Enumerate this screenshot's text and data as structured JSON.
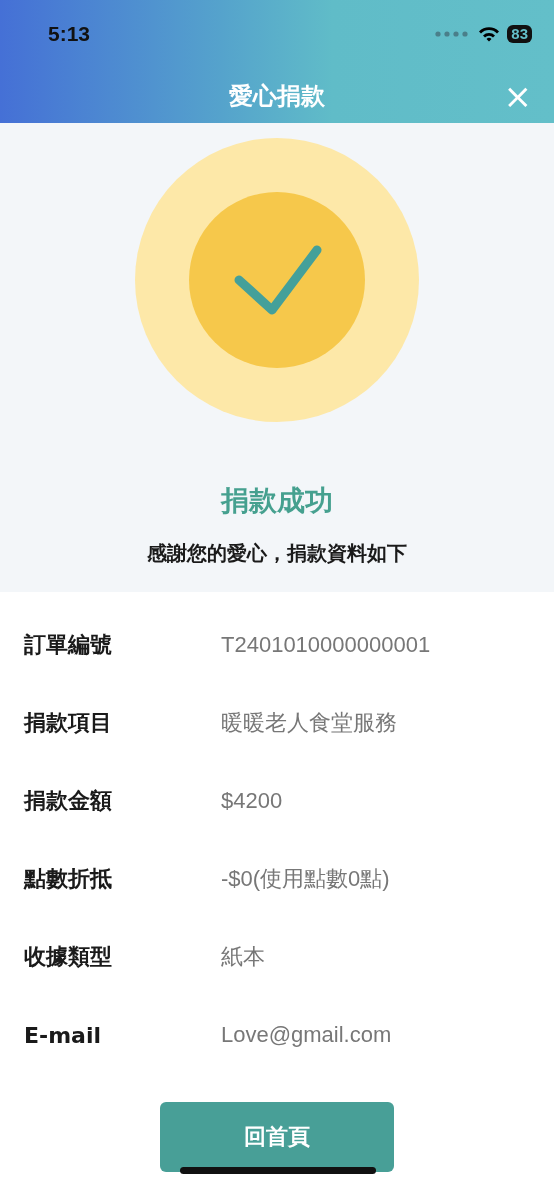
{
  "status_bar": {
    "time": "5:13",
    "battery": "83"
  },
  "header": {
    "title": "愛心捐款",
    "close": "×"
  },
  "result": {
    "title": "捐款成功",
    "subtitle": "感謝您的愛心，捐款資料如下"
  },
  "details": [
    {
      "label": "訂單編號",
      "value": "T2401010000000001"
    },
    {
      "label": "捐款項目",
      "value": "暖暖老人食堂服務"
    },
    {
      "label": "捐款金額",
      "value": "$4200"
    },
    {
      "label": "點數折抵",
      "value": "-$0(使用點數0點)"
    },
    {
      "label": "收據類型",
      "value": "紙本"
    },
    {
      "label": "E-mail",
      "value": "Love@gmail.com"
    }
  ],
  "buttons": [
    "回首頁"
  ]
}
